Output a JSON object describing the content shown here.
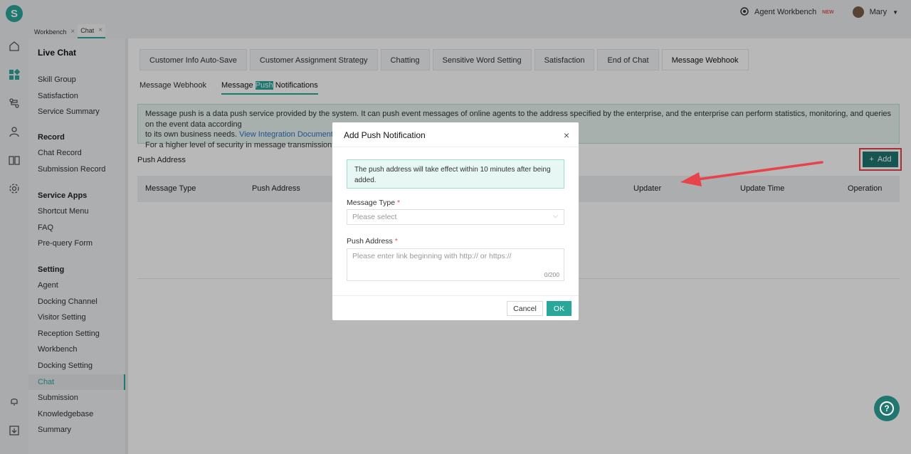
{
  "brand": {
    "logo_letter": "S",
    "accent": "#2aa79b",
    "button_dark": "#20776f"
  },
  "topbar": {
    "agent_workbench": "Agent Workbench",
    "new_badge": "NEW",
    "user": "Mary"
  },
  "tabs": [
    {
      "label": "Workbench",
      "active": false
    },
    {
      "label": "Chat",
      "active": true
    }
  ],
  "sidenav": {
    "title": "Live Chat",
    "group1": [
      "Skill Group",
      "Satisfaction",
      "Service Summary"
    ],
    "record_title": "Record",
    "record_items": [
      "Chat Record",
      "Submission Record"
    ],
    "apps_title": "Service Apps",
    "apps_items": [
      "Shortcut Menu",
      "FAQ",
      "Pre-query Form"
    ],
    "setting_title": "Setting",
    "setting_items": [
      "Agent",
      "Docking Channel",
      "Visitor Setting",
      "Reception Setting",
      "Workbench",
      "Docking Setting",
      "Chat",
      "Submission",
      "Knowledgebase",
      "Summary"
    ],
    "active_item": "Chat"
  },
  "setting_tabs": [
    "Customer Info Auto-Save",
    "Customer Assignment Strategy",
    "Chatting",
    "Sensitive Word Setting",
    "Satisfaction",
    "End of Chat",
    "Message Webhook"
  ],
  "active_setting_tab": "Message Webhook",
  "sub_tabs": {
    "first": "Message Webhook",
    "second_pre": "Message ",
    "second_hl": "Push",
    "second_post": " Notifications"
  },
  "info": {
    "line1": "Message push is a data push service provided by the system. It can push event messages of online agents to the address specified by the enterprise, and the enterprise can perform statistics, monitoring, and queries on the event data according",
    "line2_pre": "to its own business needs. ",
    "link": "View Integration Documentation",
    "line3": "For a higher level of security in message transmission, please"
  },
  "push_address_label": "Push Address",
  "add_button": "Add",
  "table_headers": [
    "Message Type",
    "Push Address",
    "Updater",
    "Update Time",
    "Operation"
  ],
  "modal": {
    "title": "Add Push Notification",
    "notice": "The push address will take effect within 10 minutes after being added.",
    "message_type_label": "Message Type",
    "message_type_placeholder": "Please select",
    "push_address_label": "Push Address",
    "push_address_placeholder": "Please enter link beginning with http:// or https://",
    "counter": "0/200",
    "cancel": "Cancel",
    "ok": "OK",
    "required_mark": "*"
  },
  "help_icon": "?"
}
